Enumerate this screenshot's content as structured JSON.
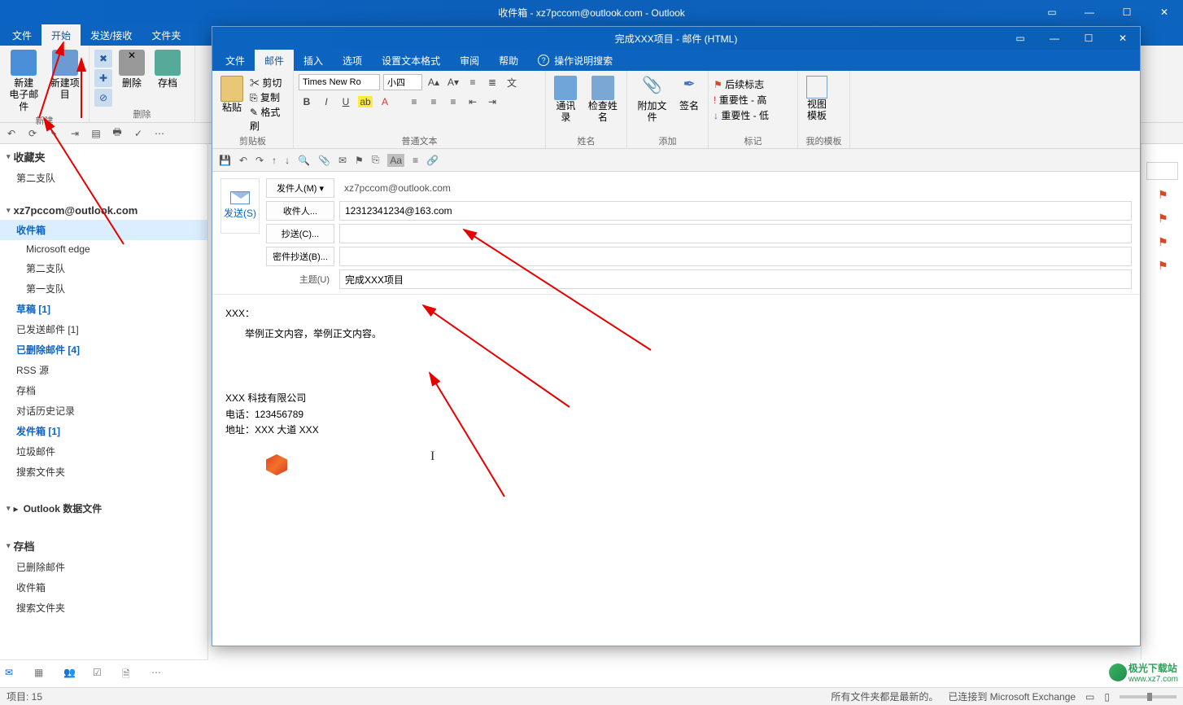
{
  "mainWindow": {
    "title": "收件箱 - xz7pccom@outlook.com - Outlook",
    "tabs": {
      "file": "文件",
      "home": "开始",
      "sendrecv": "发送/接收",
      "folder": "文件夹"
    },
    "ribbon": {
      "newMail": "新建\n电子邮件",
      "newItem": "新建项目",
      "delete": "删除",
      "archive": "存档",
      "group_new": "新建",
      "group_delete": "删除"
    }
  },
  "folderPane": {
    "favorites": "收藏夹",
    "fav1": "第二支队",
    "account": "xz7pccom@outlook.com",
    "inbox": "收件箱",
    "msedge": "Microsoft edge",
    "team2": "第二支队",
    "team1": "第一支队",
    "drafts": "草稿 [1]",
    "sent": "已发送邮件 [1]",
    "deleted": "已删除邮件 [4]",
    "rss": "RSS 源",
    "archive": "存档",
    "convHist": "对话历史记录",
    "outbox": "发件箱 [1]",
    "junk": "垃圾邮件",
    "search": "搜索文件夹",
    "dataFile": "Outlook 数据文件",
    "archiveHdr": "存档",
    "archDel": "已删除邮件",
    "archInbox": "收件箱",
    "archSearch": "搜索文件夹"
  },
  "compose": {
    "title": "完成XXX项目 - 邮件 (HTML)",
    "tabs": {
      "file": "文件",
      "message": "邮件",
      "insert": "插入",
      "options": "选项",
      "format": "设置文本格式",
      "review": "审阅",
      "help": "帮助",
      "tellme": "操作说明搜索"
    },
    "ribbon": {
      "paste": "粘贴",
      "cut": "剪切",
      "copy": "复制",
      "formatPainter": "格式刷",
      "clipboard": "剪贴板",
      "font": "Times New Ro",
      "size": "小四",
      "normalText": "普通文本",
      "addressBook": "通讯录",
      "checkNames": "检查姓名",
      "names": "姓名",
      "attach": "附加文件",
      "signature": "签名",
      "add": "添加",
      "followup": "后续标志",
      "highImp": "重要性 - 高",
      "lowImp": "重要性 - 低",
      "tags": "标记",
      "viewTemplates": "视图\n模板",
      "myTemplates": "我的模板"
    },
    "fields": {
      "send": "发送(S)",
      "fromLabel": "发件人(M) ▾",
      "fromValue": "xz7pccom@outlook.com",
      "toLabel": "收件人...",
      "toValue": "12312341234@163.com",
      "ccLabel": "抄送(C)...",
      "ccValue": "",
      "bccLabel": "密件抄送(B)...",
      "bccValue": "",
      "subjectLabel": "主题(U)",
      "subjectValue": "完成XXX项目"
    },
    "body": {
      "greeting": "XXX：",
      "content": "举例正文内容，举例正文内容。",
      "company": "XXX 科技有限公司",
      "phone": "电话：123456789",
      "address": "地址：XXX 大道 XXX"
    }
  },
  "statusBar": {
    "items": "项目: 15",
    "allUpdated": "所有文件夹都是最新的。",
    "connected": "已连接到 Microsoft Exchange"
  },
  "watermark": {
    "brand": "极光下载站",
    "url": "www.xz7.com"
  }
}
